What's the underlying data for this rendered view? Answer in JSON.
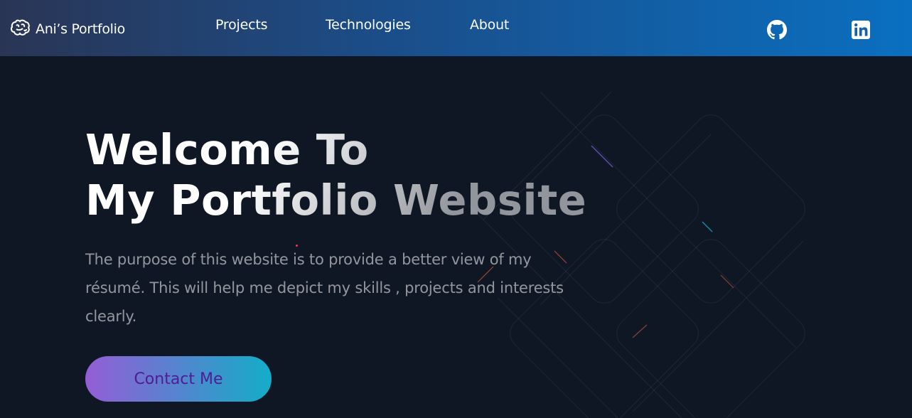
{
  "header": {
    "logo_text": "Ani’s Portfolio",
    "logo_icon": "brain-icon",
    "nav": [
      {
        "label": "Projects"
      },
      {
        "label": "Technologies"
      },
      {
        "label": "About"
      }
    ],
    "social": [
      {
        "icon": "github-icon"
      },
      {
        "icon": "linkedin-icon"
      }
    ]
  },
  "hero": {
    "title_line1": "Welcome To",
    "title_line2": "My Portfolio Website",
    "description": "The purpose of this website is to provide a better view of my résumé. This will help me depict my skills , projects and interests clearly.",
    "cta_label": "Contact Me"
  },
  "colors": {
    "background": "#0f1624",
    "header_gradient_start": "#2a3555",
    "header_gradient_end": "#0a6fc0",
    "cta_gradient_start": "#945dd6",
    "cta_gradient_end": "#13adc7",
    "cta_text": "#4c1d95"
  }
}
